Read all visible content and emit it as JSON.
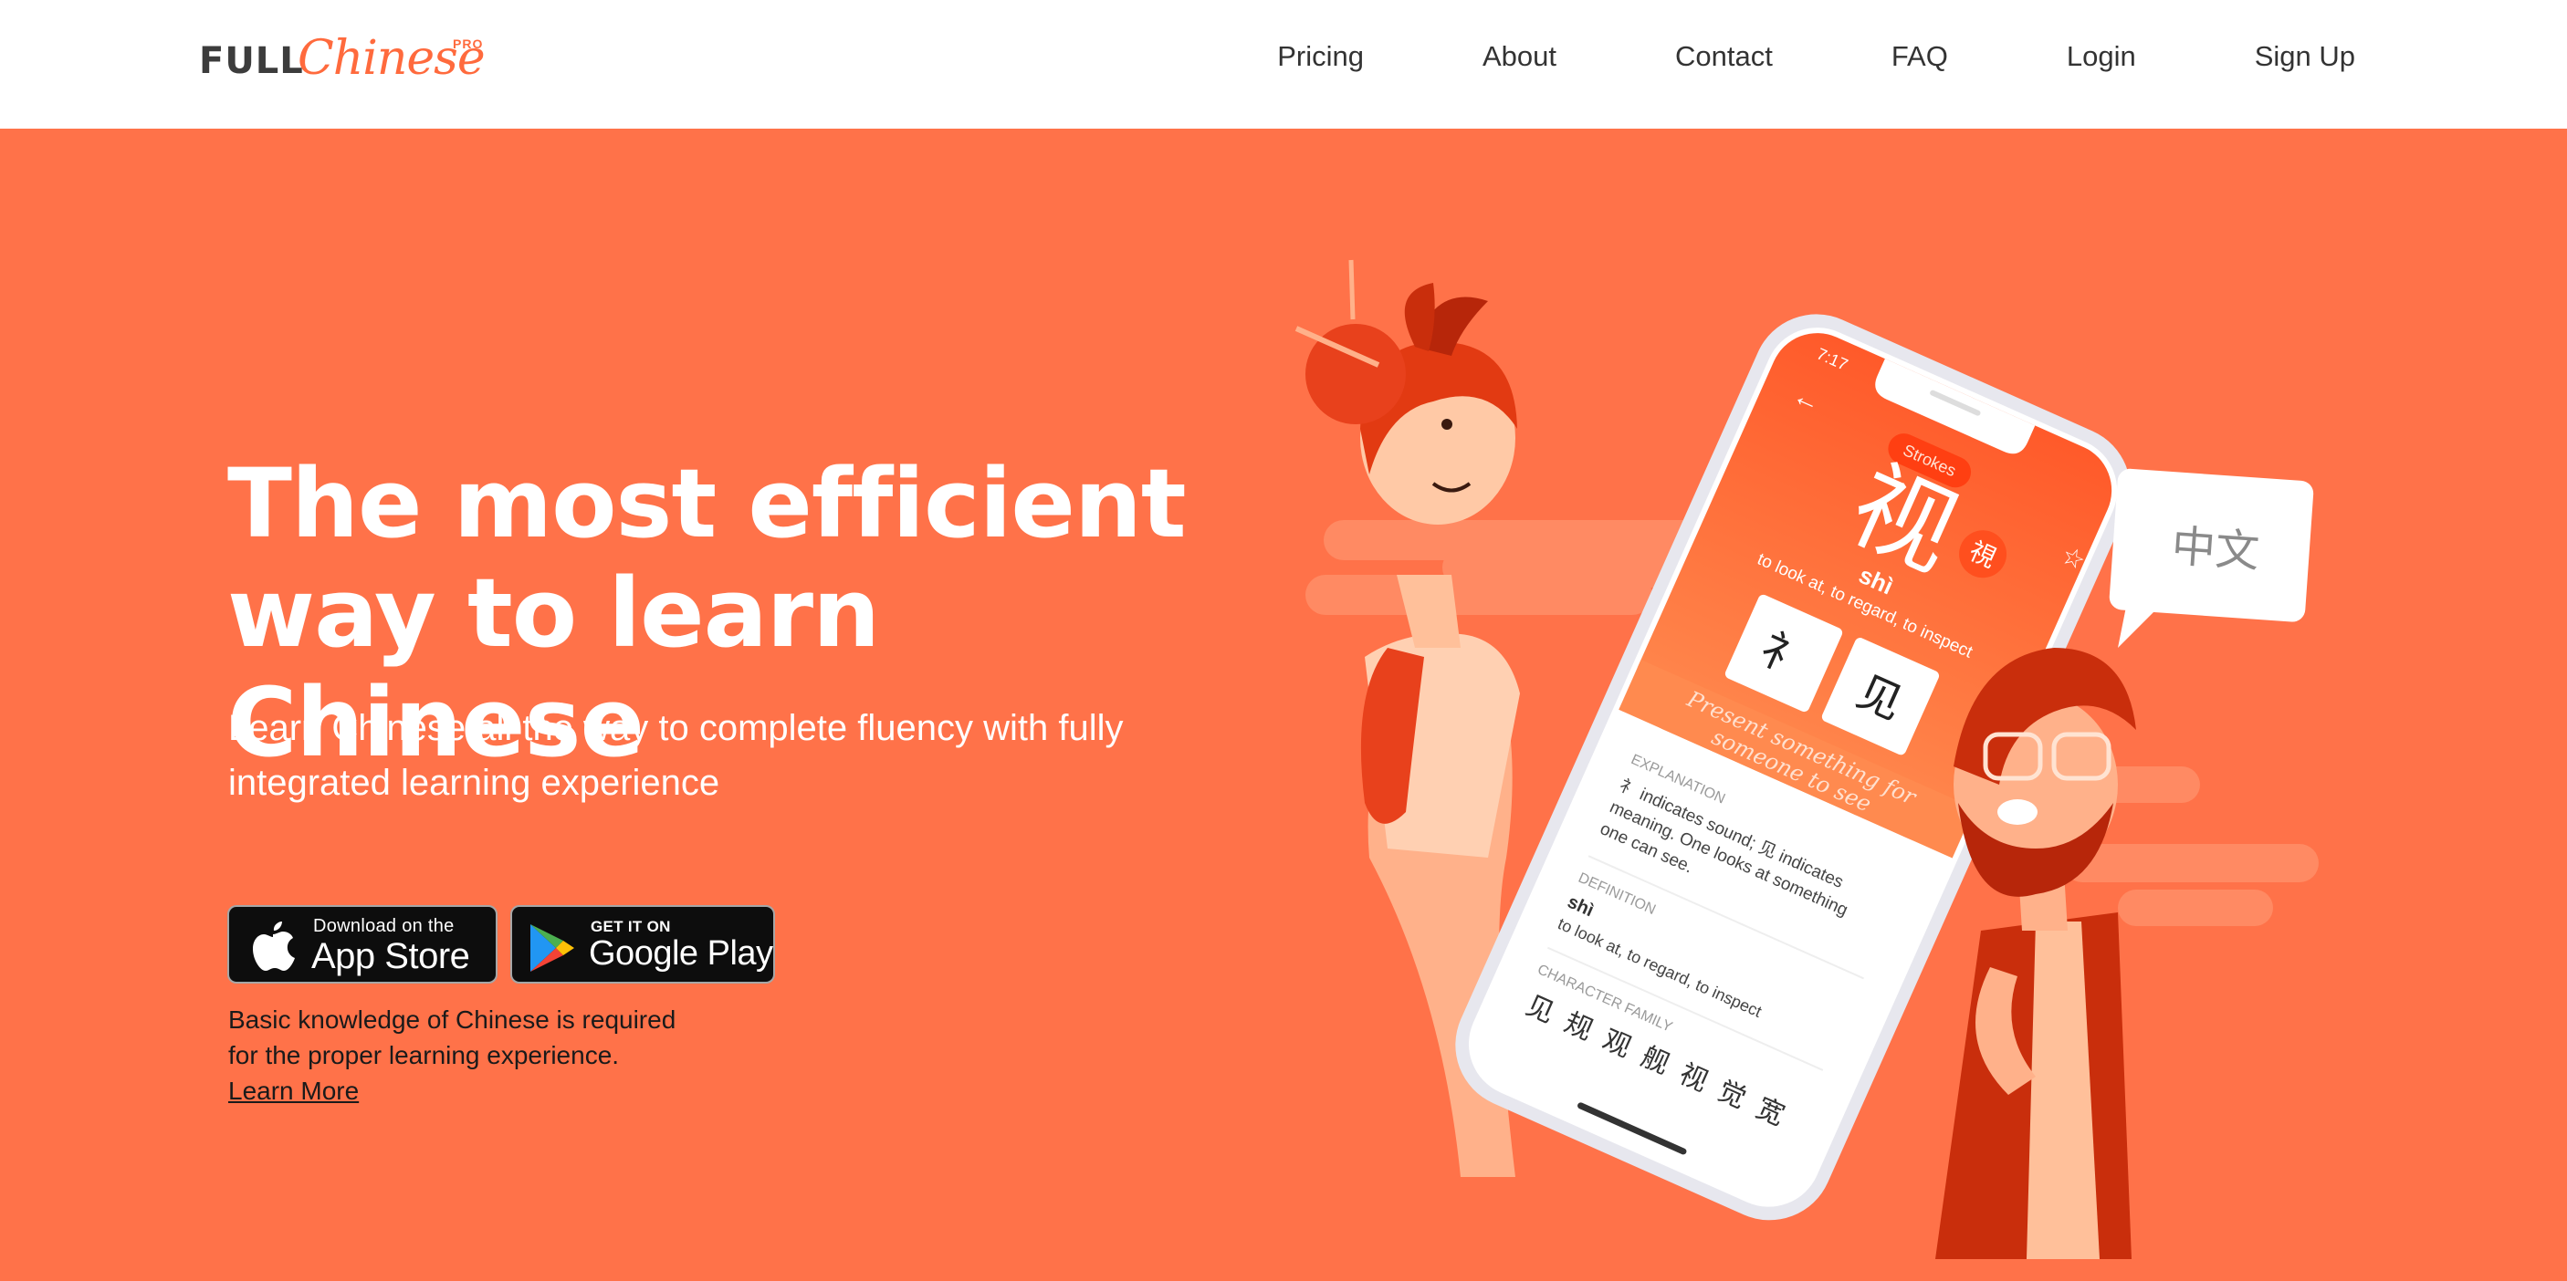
{
  "header": {
    "logo": {
      "full": "FULL",
      "chinese": "Chinese",
      "pro": "PRO"
    },
    "nav": [
      "Pricing",
      "About",
      "Contact",
      "FAQ",
      "Login",
      "Sign Up"
    ]
  },
  "hero": {
    "title_line1": "The most efficient",
    "title_line2": "way to learn Chinese",
    "subtitle": "Learn Chinese all the way to complete fluency with fully integrated learning experience",
    "app_store": {
      "small": "Download on the",
      "big": "App Store"
    },
    "google_play": {
      "small": "GET IT ON",
      "big": "Google Play"
    },
    "note_line1": "Basic knowledge of Chinese is required",
    "note_line2": "for the proper learning experience.",
    "learn_more": "Learn More"
  },
  "phone": {
    "time": "7:17",
    "strokes_badge": "Strokes",
    "character": "视",
    "traditional": "視",
    "pinyin": "shì",
    "meaning": "to look at, to regard, to inspect",
    "component_1": "礻",
    "component_2": "见",
    "phrase_line1": "Present something for",
    "phrase_line2": "someone to see",
    "explanation_label": "EXPLANATION",
    "explanation_line1": "礻 indicates sound; 见 indicates",
    "explanation_line2": "meaning. One looks at something",
    "explanation_line3": "one can see.",
    "definition_label": "DEFINITION",
    "definition_pinyin": "shì",
    "definition_meaning": "to look at, to regard, to inspect",
    "family_label": "CHARACTER FAMILY",
    "family": [
      "见",
      "规",
      "观",
      "舰",
      "视",
      "觉",
      "宽"
    ]
  },
  "speech_bubble": "中文",
  "colors": {
    "hero_bg": "#ff7249",
    "brand": "#ff6a3d",
    "text_dark": "#333333"
  }
}
